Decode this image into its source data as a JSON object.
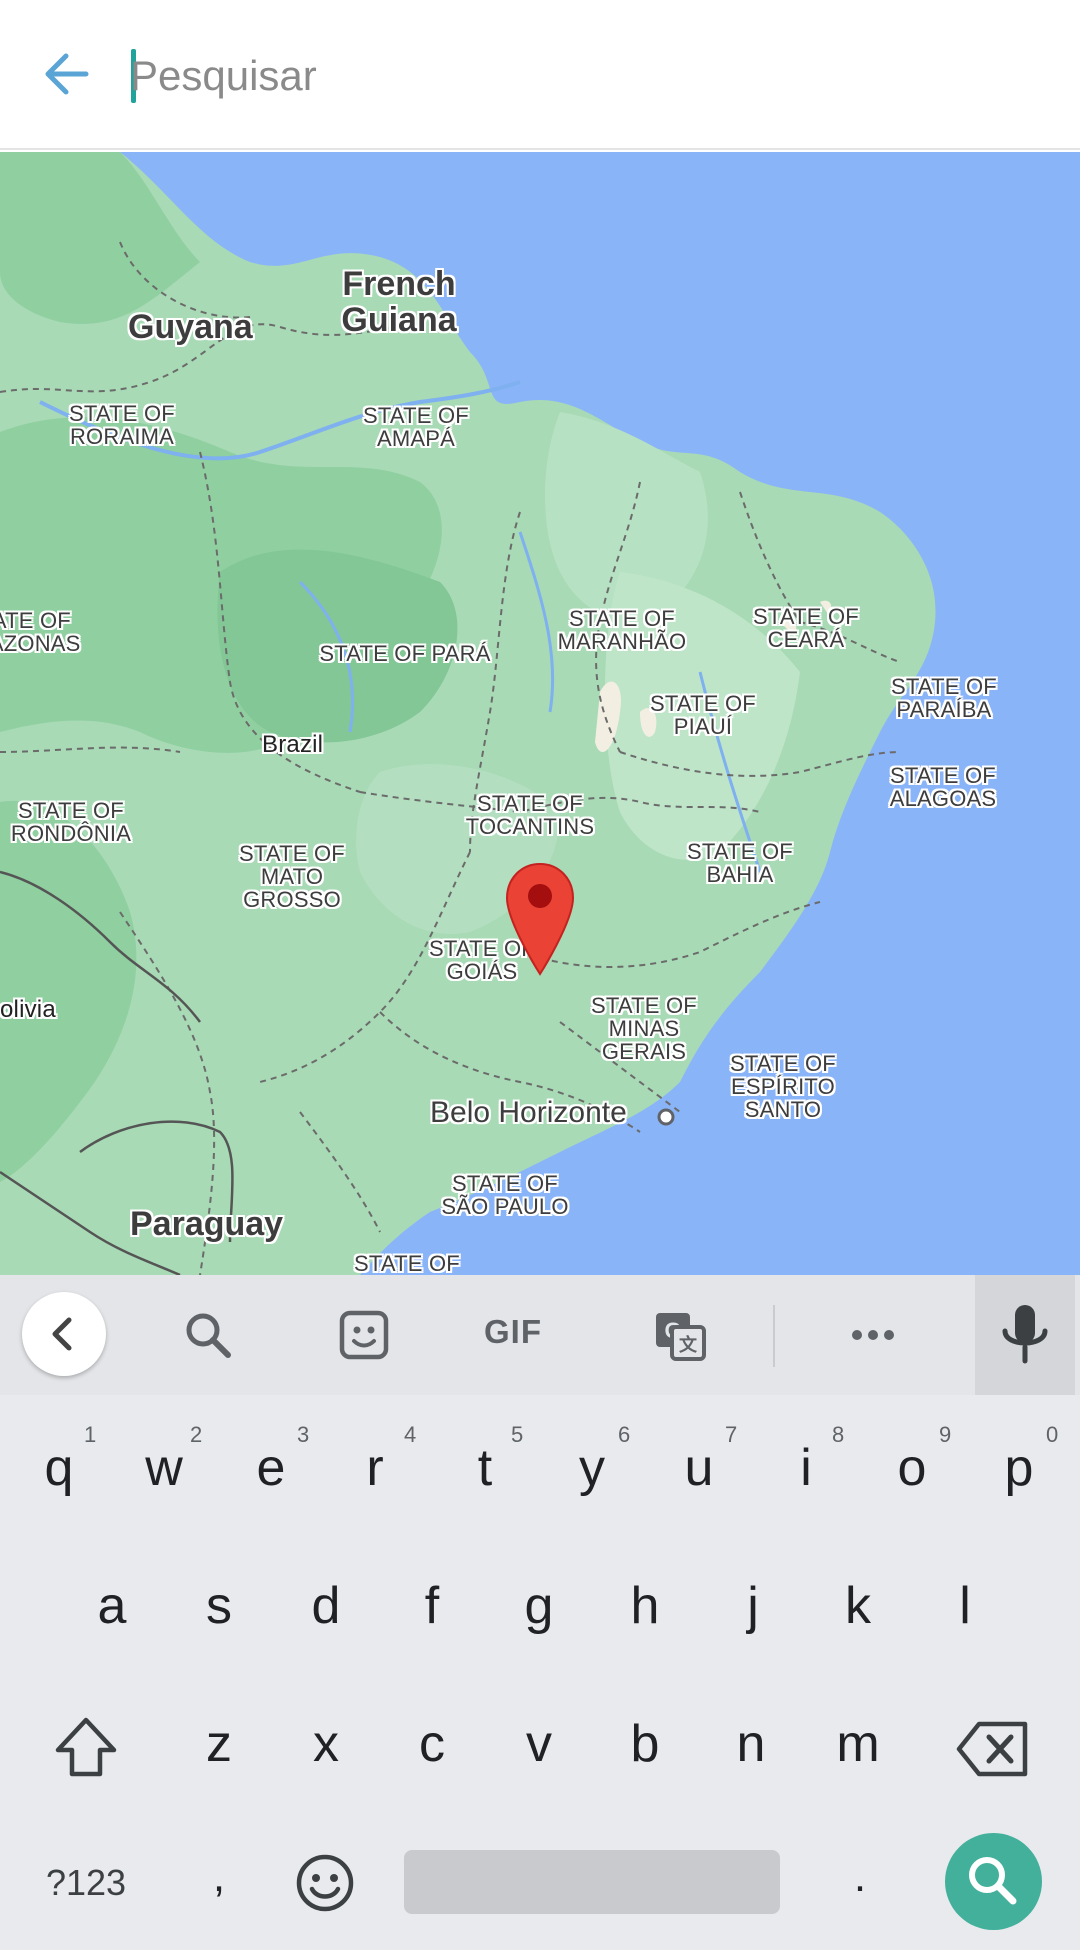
{
  "search": {
    "placeholder": "Pesquisar",
    "value": ""
  },
  "map": {
    "countries": [
      "Guyana",
      "French Guiana",
      "Brazil",
      "Paraguay",
      "olivia"
    ],
    "states": [
      "STATE OF RORAIMA",
      "STATE OF AMAPÁ",
      "STATE OF AMAZONAS",
      "STATE OF PARÁ",
      "STATE OF MARANHÃO",
      "STATE OF CEARÁ",
      "STATE OF PARAÍBA",
      "STATE OF PIAUÍ",
      "STATE OF ALAGOAS",
      "STATE OF RONDÔNIA",
      "STATE OF TOCANTINS",
      "STATE OF BAHIA",
      "STATE OF MATO GROSSO",
      "STATE OF GOIÁS",
      "STATE OF MINAS GERAIS",
      "STATE OF ESPÍRITO SANTO",
      "STATE OF SÃO PAULO",
      "STATE OF"
    ],
    "city": "Belo Horizonte",
    "colors": {
      "water": "#8ab4f8",
      "land": "#a8dab5",
      "pin": "#ea4335"
    }
  },
  "keyboard": {
    "toolbar": {
      "gif_label": "GIF",
      "icons": [
        "chevron-left-icon",
        "search-icon",
        "sticker-icon",
        "gif-icon",
        "translate-icon",
        "more-icon",
        "mic-icon"
      ]
    },
    "row1": {
      "keys": [
        "q",
        "w",
        "e",
        "r",
        "t",
        "y",
        "u",
        "i",
        "o",
        "p"
      ],
      "hints": [
        "1",
        "2",
        "3",
        "4",
        "5",
        "6",
        "7",
        "8",
        "9",
        "0"
      ]
    },
    "row2": {
      "keys": [
        "a",
        "s",
        "d",
        "f",
        "g",
        "h",
        "j",
        "k",
        "l"
      ]
    },
    "row3": {
      "keys": [
        "z",
        "x",
        "c",
        "v",
        "b",
        "n",
        "m"
      ]
    },
    "row4": {
      "symbols_label": "?123",
      "comma": ",",
      "period": "."
    },
    "accent": "#42b09b"
  }
}
